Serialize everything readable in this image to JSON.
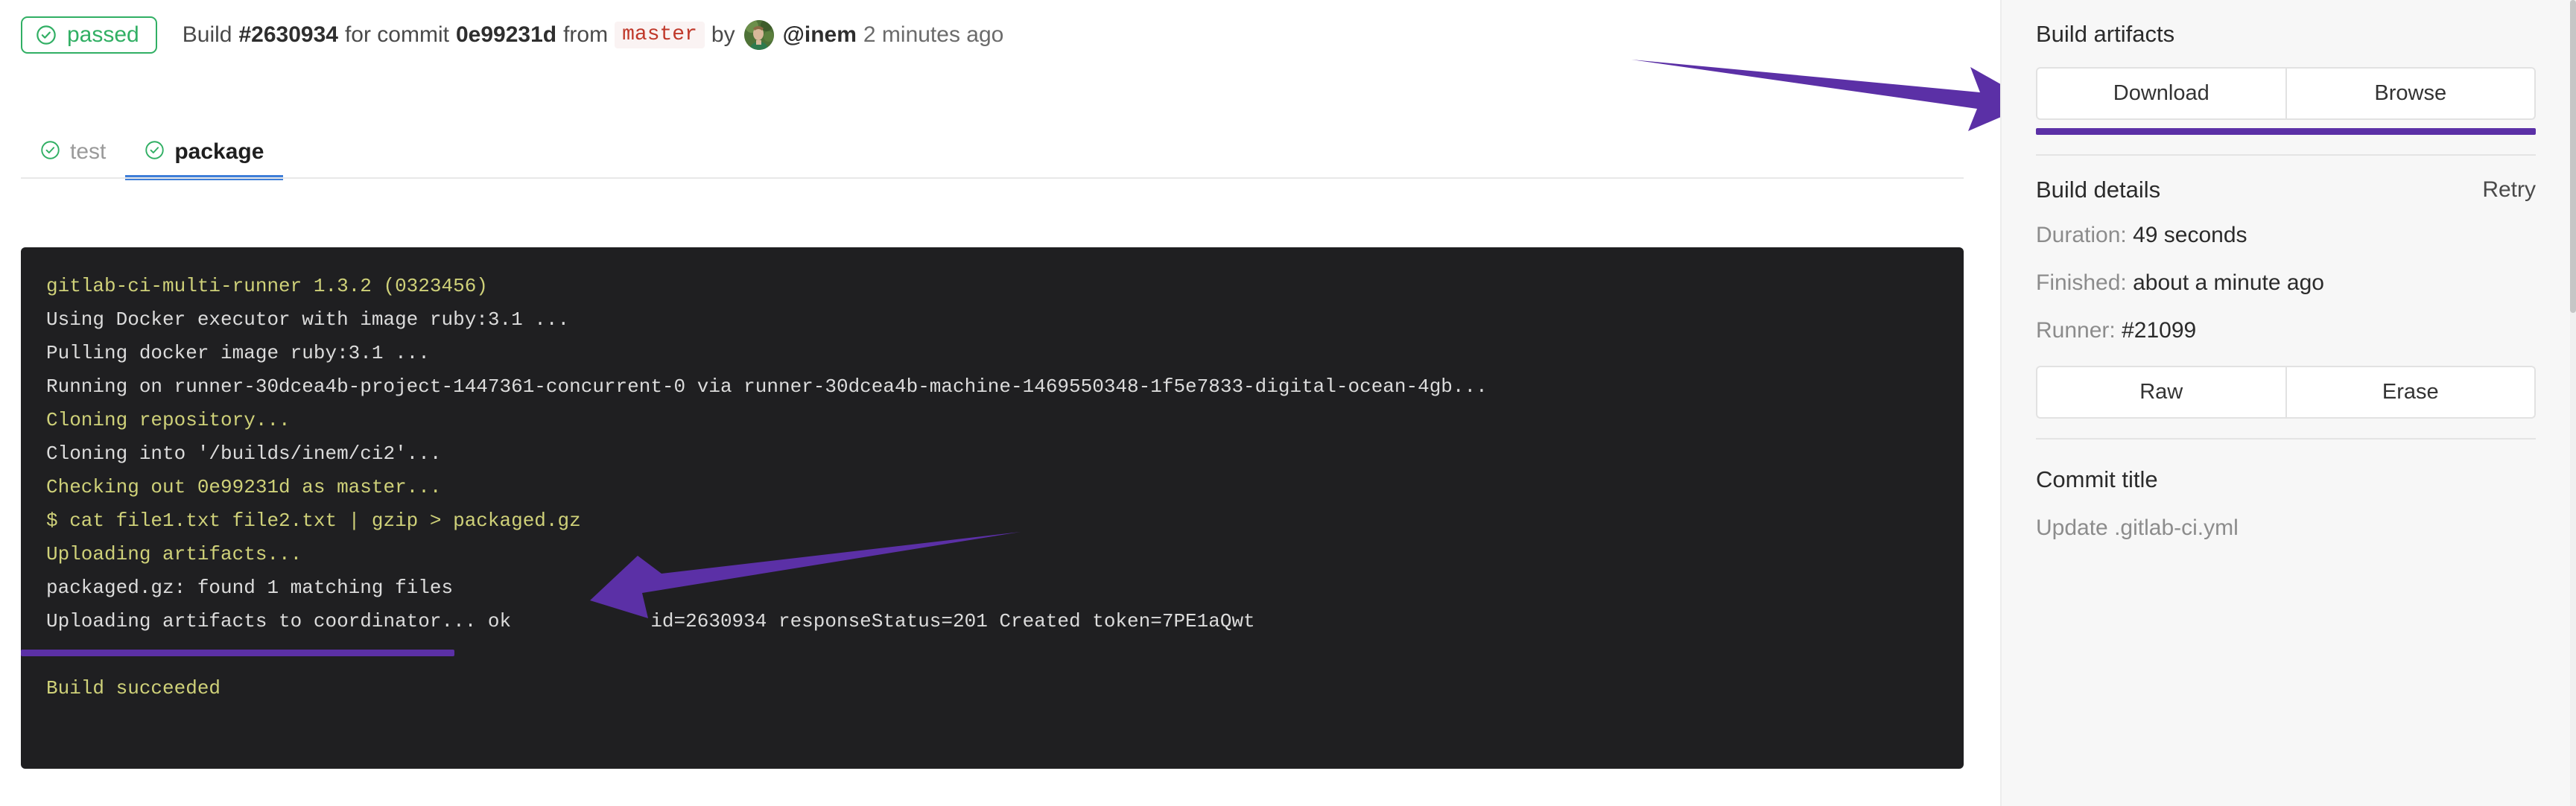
{
  "header": {
    "status": "passed",
    "status_color": "#31af64",
    "build_word": "Build",
    "build_number": "#2630934",
    "for_commit": "for commit",
    "commit_sha": "0e99231d",
    "from_word": "from",
    "branch": "master",
    "by_word": "by",
    "user": "@inem",
    "time_ago": "2 minutes ago"
  },
  "tabs": [
    {
      "label": "test",
      "active": false
    },
    {
      "label": "package",
      "active": true
    }
  ],
  "terminal": {
    "lines": [
      {
        "text": "gitlab-ci-multi-runner 1.3.2 (0323456)",
        "color": "yellow"
      },
      {
        "text": "Using Docker executor with image ruby:3.1 ...",
        "color": "white"
      },
      {
        "text": "Pulling docker image ruby:3.1 ...",
        "color": "white"
      },
      {
        "text": "Running on runner-30dcea4b-project-1447361-concurrent-0 via runner-30dcea4b-machine-1469550348-1f5e7833-digital-ocean-4gb...",
        "color": "white"
      },
      {
        "text": "Cloning repository...",
        "color": "yellow"
      },
      {
        "text": "Cloning into '/builds/inem/ci2'...",
        "color": "white"
      },
      {
        "text": "Checking out 0e99231d as master...",
        "color": "yellow"
      },
      {
        "text": "$ cat file1.txt file2.txt | gzip > packaged.gz",
        "color": "yellow"
      },
      {
        "text": "Uploading artifacts...",
        "color": "yellow"
      },
      {
        "text": "packaged.gz: found 1 matching files",
        "color": "white"
      },
      {
        "text": "Uploading artifacts to coordinator... ok            id=2630934 responseStatus=201 Created token=7PE1aQwt",
        "color": "white"
      },
      {
        "text": "",
        "color": "white"
      },
      {
        "text": "Build succeeded",
        "color": "yellow"
      }
    ]
  },
  "sidebar": {
    "artifacts_title": "Build artifacts",
    "download_label": "Download",
    "browse_label": "Browse",
    "details_title": "Build details",
    "retry_label": "Retry",
    "duration_label": "Duration:",
    "duration_value": "49 seconds",
    "finished_label": "Finished:",
    "finished_value": "about a minute ago",
    "runner_label": "Runner:",
    "runner_value": "#21099",
    "raw_label": "Raw",
    "erase_label": "Erase",
    "commit_title_label": "Commit title",
    "commit_title_value": "Update .gitlab-ci.yml"
  },
  "annotations": {
    "color": "#5b30a6",
    "arrow_top_target": "download-button",
    "arrow_log_target": "packaged-gz-line"
  }
}
